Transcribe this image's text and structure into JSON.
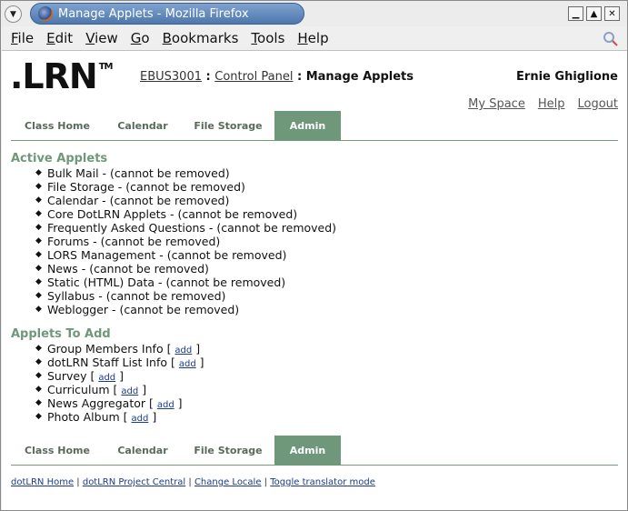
{
  "window": {
    "title": "Manage Applets - Mozilla Firefox"
  },
  "menubar": {
    "items": [
      {
        "label": "File"
      },
      {
        "label": "Edit"
      },
      {
        "label": "View"
      },
      {
        "label": "Go"
      },
      {
        "label": "Bookmarks"
      },
      {
        "label": "Tools"
      },
      {
        "label": "Help"
      }
    ]
  },
  "header": {
    "logo": ".LRN",
    "logo_tm": "TM",
    "breadcrumb": {
      "course": "EBUS3001",
      "sep1": " : ",
      "control_panel": "Control Panel",
      "sep2": " : ",
      "current": "Manage Applets"
    },
    "user_name": "Ernie Ghiglione",
    "links": {
      "my_space": "My Space",
      "help": "Help",
      "logout": "Logout"
    }
  },
  "tabs": [
    {
      "label": "Class Home"
    },
    {
      "label": "Calendar"
    },
    {
      "label": "File Storage"
    },
    {
      "label": "Admin"
    }
  ],
  "active_applets": {
    "title": "Active Applets",
    "items": [
      "Bulk Mail - (cannot be removed)",
      "File Storage - (cannot be removed)",
      "Calendar - (cannot be removed)",
      "Core DotLRN Applets - (cannot be removed)",
      "Frequently Asked Questions - (cannot be removed)",
      "Forums - (cannot be removed)",
      "LORS Management - (cannot be removed)",
      "News - (cannot be removed)",
      "Static (HTML) Data - (cannot be removed)",
      "Syllabus - (cannot be removed)",
      "Weblogger - (cannot be removed)"
    ]
  },
  "applets_to_add": {
    "title": "Applets To Add",
    "add_label": "add",
    "items": [
      "Group Members Info",
      "dotLRN Staff List Info",
      "Survey",
      "Curriculum",
      "News Aggregator",
      "Photo Album"
    ]
  },
  "footer": {
    "links": [
      "dotLRN Home",
      "dotLRN Project Central",
      "Change Locale",
      "Toggle translator mode"
    ],
    "sep": " | "
  }
}
